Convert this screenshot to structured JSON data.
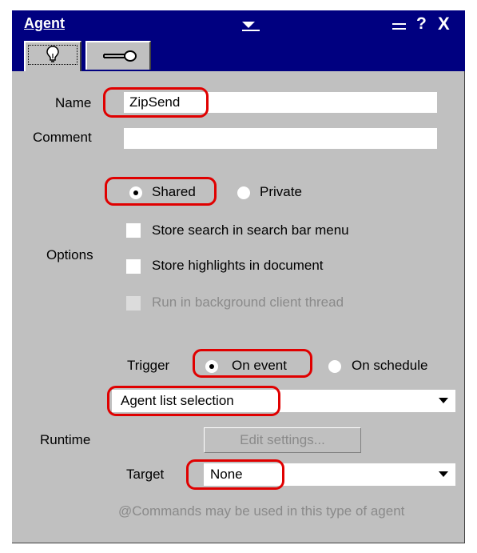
{
  "window": {
    "title": "Agent",
    "buttons": {
      "minimize": "minimize-icon",
      "help": "?",
      "close": "X"
    }
  },
  "tabs": [
    {
      "icon": "lightbulb-icon",
      "selected": true
    },
    {
      "icon": "key-icon",
      "selected": false
    }
  ],
  "form": {
    "name_label": "Name",
    "name_value": "ZipSend",
    "comment_label": "Comment",
    "comment_value": "",
    "options_label": "Options",
    "sharing": {
      "shared_label": "Shared",
      "private_label": "Private",
      "selected": "Shared"
    },
    "checkboxes": [
      {
        "label": "Store search in search bar menu",
        "checked": false,
        "enabled": true
      },
      {
        "label": "Store highlights in document",
        "checked": false,
        "enabled": true
      },
      {
        "label": "Run in background client thread",
        "checked": false,
        "enabled": false
      }
    ],
    "runtime_label": "Runtime",
    "trigger": {
      "label": "Trigger",
      "on_event_label": "On event",
      "on_schedule_label": "On schedule",
      "selected": "On event"
    },
    "event_select_value": "Agent list selection",
    "edit_settings_label": "Edit settings...",
    "target_label": "Target",
    "target_value": "None",
    "note": "@Commands may be used in this type of agent"
  },
  "colors": {
    "titlebar": "#000080",
    "panel": "#c0c0c0",
    "highlight": "#e00000"
  }
}
